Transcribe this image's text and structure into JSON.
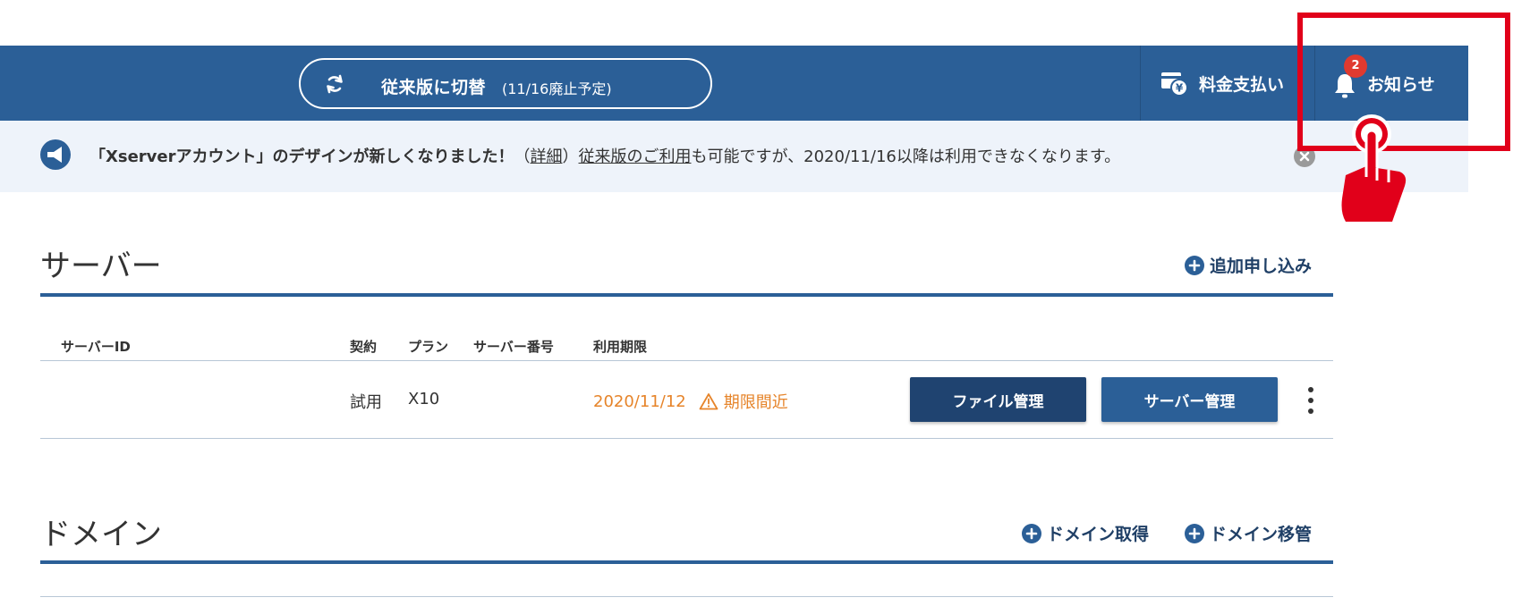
{
  "topbar": {
    "switch": {
      "main": "従来版に切替",
      "sub": "(11/16廃止予定)"
    },
    "payment_label": "料金支払い",
    "notice_label": "お知らせ",
    "notice_badge": "2"
  },
  "announcement": {
    "bold": "「Xserverアカウント」のデザインが新しくなりました！",
    "paren_open": "（",
    "detail_link": "詳細",
    "paren_close": "）",
    "legacy_link": "従来版のご利用",
    "rest": "も可能ですが、2020/11/16以降は利用できなくなります。"
  },
  "server_section": {
    "title": "サーバー",
    "add_label": "追加申し込み",
    "headers": {
      "server_id": "サーバーID",
      "contract": "契約",
      "plan": "プラン",
      "server_no": "サーバー番号",
      "expiry": "利用期限"
    },
    "row": {
      "server_id": "",
      "contract": "試用",
      "plan": "X10",
      "server_no": "",
      "expiry_date": "2020/11/12",
      "expiry_warning": "期限間近"
    },
    "file_button": "ファイル管理",
    "server_button": "サーバー管理"
  },
  "domain_section": {
    "title": "ドメイン",
    "acquire_label": "ドメイン取得",
    "transfer_label": "ドメイン移管"
  },
  "colors": {
    "nav": "#2b5f97",
    "announce_bg": "#eef3fa",
    "warning": "#e6842a",
    "highlight": "#e1001a",
    "badge": "#e03a2f"
  }
}
